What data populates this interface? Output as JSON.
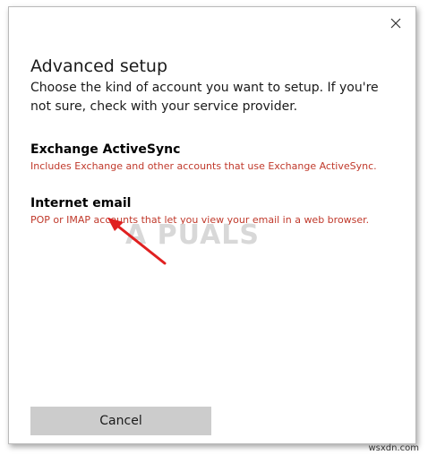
{
  "dialog": {
    "close_glyph": "✕",
    "title": "Advanced setup",
    "description": "Choose the kind of account you want to setup. If you're not sure, check with your service provider.",
    "options": [
      {
        "title": "Exchange ActiveSync",
        "subtitle": "Includes Exchange and other accounts that use Exchange ActiveSync."
      },
      {
        "title": "Internet email",
        "subtitle": "POP or IMAP accounts that let you view your email in a web browser."
      }
    ],
    "cancel_label": "Cancel"
  },
  "watermark": "A PUALS",
  "credit": "wsxdn.com",
  "colors": {
    "accent_red": "#c0392b",
    "button_gray": "#cccccc",
    "arrow_red": "#e02020"
  },
  "icons": {
    "close": "close-icon",
    "annotation": "red-arrow-icon"
  }
}
